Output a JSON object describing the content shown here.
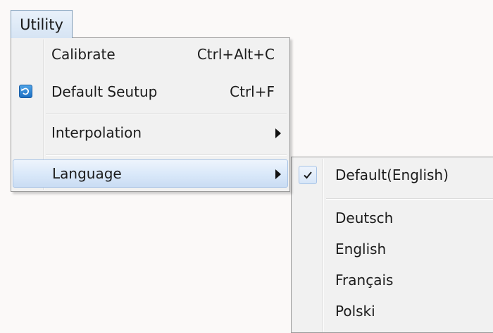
{
  "menubar": {
    "utility_label": "Utility"
  },
  "menu": {
    "items": [
      {
        "label": "Calibrate",
        "shortcut": "Ctrl+Alt+C",
        "icon": null
      },
      {
        "label": "Default Seutup",
        "shortcut": "Ctrl+F",
        "icon": "default-setup-icon"
      },
      {
        "label": "Interpolation",
        "shortcut": "",
        "icon": "submenu-arrow-icon"
      },
      {
        "label": "Language",
        "shortcut": "",
        "icon": "submenu-arrow-icon",
        "state": "highlighted"
      }
    ]
  },
  "language_submenu": {
    "items": [
      {
        "label": "Default(English)",
        "checked": true
      },
      {
        "label": "Deutsch",
        "checked": false
      },
      {
        "label": "English",
        "checked": false
      },
      {
        "label": "Français",
        "checked": false
      },
      {
        "label": "Polski",
        "checked": false
      }
    ]
  },
  "colors": {
    "highlight_border": "#a9c4e6",
    "highlight_fill": "#d9e8f9",
    "menu_background": "#f1f1f1",
    "icon_blue": "#1c6fc2"
  }
}
